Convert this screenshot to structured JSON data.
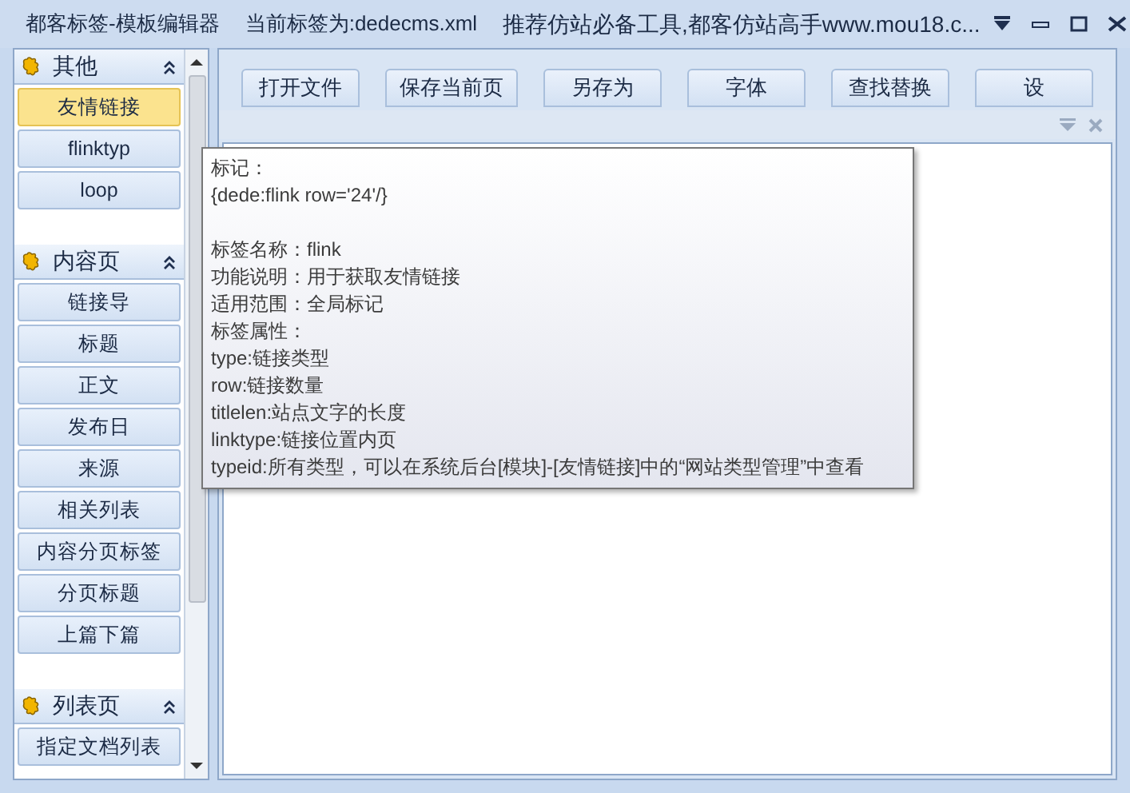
{
  "window": {
    "title": "都客标签-模板编辑器",
    "current_tag": "当前标签为:dedecms.xml",
    "promo": "推荐仿站必备工具,都客仿站高手www.mou18.c..."
  },
  "sidebar": {
    "sections": [
      {
        "title": "其他",
        "expanded": true,
        "items": [
          {
            "label": "友情链接",
            "selected": true
          },
          {
            "label": "flinktyp",
            "selected": false
          },
          {
            "label": "loop",
            "selected": false
          }
        ]
      },
      {
        "title": "内容页",
        "expanded": true,
        "items": [
          {
            "label": "链接导",
            "selected": false
          },
          {
            "label": "标题",
            "selected": false
          },
          {
            "label": "正文",
            "selected": false
          },
          {
            "label": "发布日",
            "selected": false
          },
          {
            "label": "来源",
            "selected": false
          },
          {
            "label": "相关列表",
            "selected": false
          },
          {
            "label": "内容分页标签",
            "selected": false
          },
          {
            "label": "分页标题",
            "selected": false
          },
          {
            "label": "上篇下篇",
            "selected": false
          }
        ]
      },
      {
        "title": "列表页",
        "expanded": true,
        "items": [
          {
            "label": "指定文档列表",
            "selected": false
          }
        ]
      }
    ]
  },
  "toolbar": [
    "打开文件",
    "保存当前页",
    "另存为",
    "字体",
    "查找替换",
    "设"
  ],
  "tooltip": {
    "syntax_lines": [
      "标记：",
      "{dede:flink row='24'/}"
    ],
    "detail_lines": [
      "标签名称：flink",
      "功能说明：用于获取友情链接",
      "适用范围：全局标记",
      "标签属性：",
      "type:链接类型",
      "row:链接数量",
      "titlelen:站点文字的长度",
      "linktype:链接位置内页",
      "typeid:所有类型，可以在系统后台[模块]-[友情链接]中的“网站类型管理”中查看"
    ]
  }
}
